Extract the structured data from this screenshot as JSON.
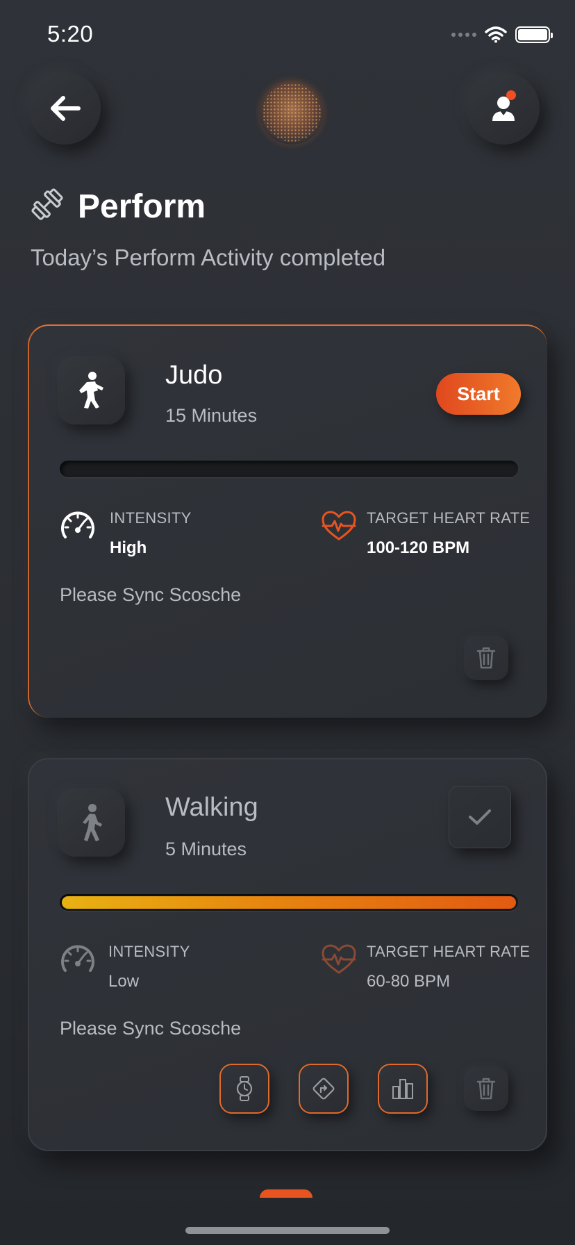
{
  "status_bar": {
    "time": "5:20"
  },
  "header": {
    "back_icon": "arrow-left-icon",
    "profile_icon": "user-avatar-icon",
    "title": "Perform",
    "subtitle": "Today’s Perform Activity completed"
  },
  "activities": [
    {
      "name": "Judo",
      "duration": "15 Minutes",
      "action_label": "Start",
      "progress": 0,
      "intensity_label": "INTENSITY",
      "intensity_value": "High",
      "heart_label": "TARGET HEART RATE",
      "heart_value": "100-120 BPM",
      "sync_text": "Please Sync Scosche"
    },
    {
      "name": "Walking",
      "duration": "5 Minutes",
      "completed": true,
      "progress": 1.0,
      "intensity_label": "INTENSITY",
      "intensity_value": "Low",
      "heart_label": "TARGET HEART RATE",
      "heart_value": "60-80 BPM",
      "sync_text": "Please Sync Scosche",
      "tools": [
        "watch-icon",
        "directions-icon",
        "bar-chart-icon"
      ]
    }
  ],
  "colors": {
    "accent": "#e8541f",
    "gold": "#e8b213",
    "background": "#2d3035"
  }
}
